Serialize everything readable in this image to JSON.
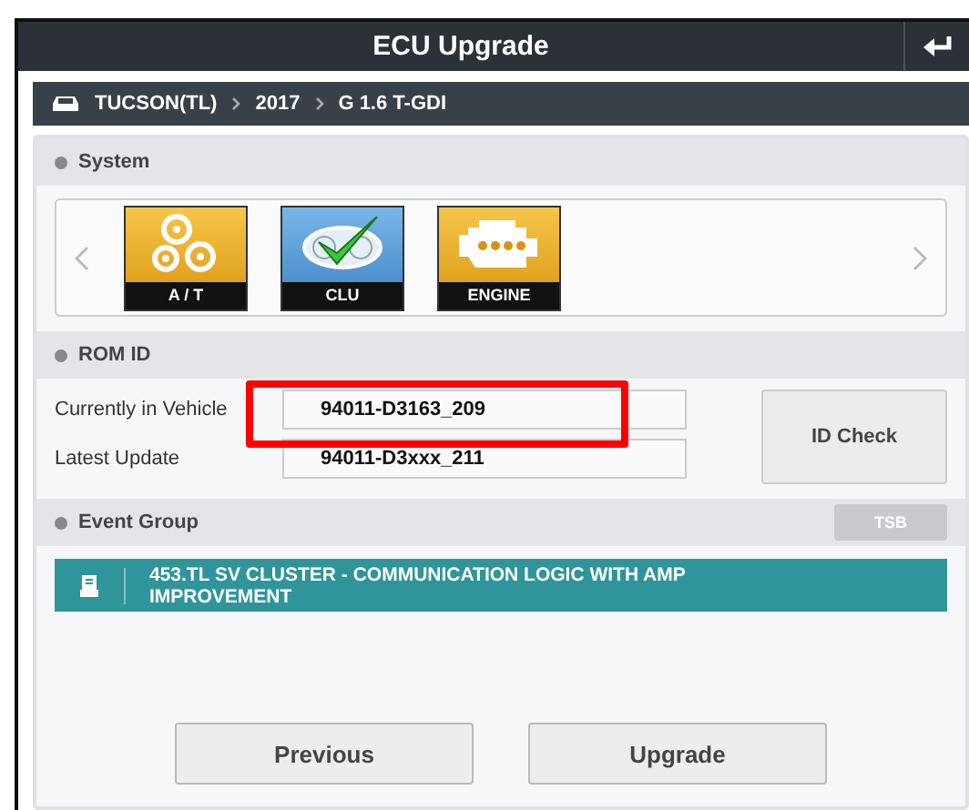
{
  "window": {
    "title": "ECU Upgrade"
  },
  "breadcrumb": [
    "TUCSON(TL)",
    "2017",
    "G 1.6 T-GDI"
  ],
  "system": {
    "heading": "System",
    "items": [
      {
        "label": "A / T",
        "kind": "gears"
      },
      {
        "label": "CLU",
        "kind": "cluster"
      },
      {
        "label": "ENGINE",
        "kind": "engine"
      }
    ]
  },
  "rom_id": {
    "heading": "ROM ID",
    "rows": [
      {
        "label": "Currently in Vehicle",
        "value": "94011-D3163_209"
      },
      {
        "label": "Latest Update",
        "value": "94011-D3xxx_211"
      }
    ],
    "button": "ID Check"
  },
  "event_group": {
    "heading": "Event Group",
    "button": "TSB",
    "items": [
      {
        "text": "453.TL SV CLUSTER - COMMUNICATION LOGIC WITH AMP IMPROVEMENT",
        "selected": true
      }
    ]
  },
  "buttons": [
    "Previous",
    "Upgrade"
  ],
  "highlight_box": true
}
